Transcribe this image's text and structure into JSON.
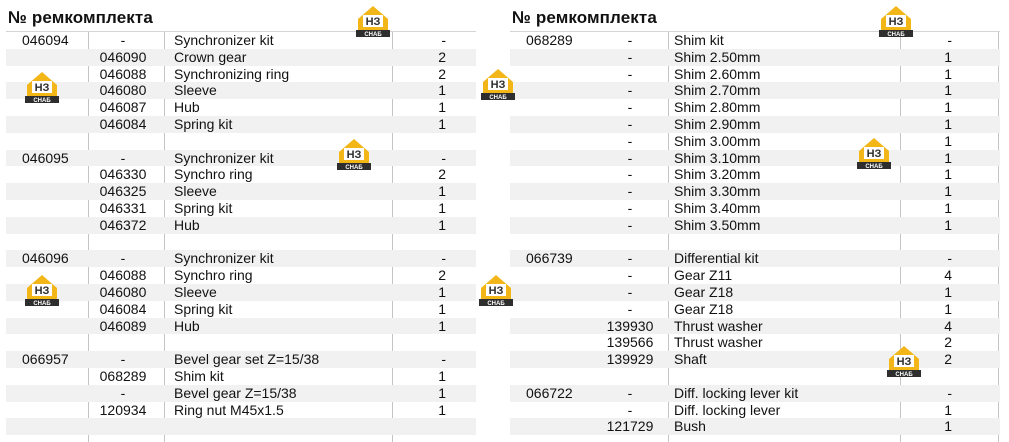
{
  "header": "№ ремкомплекта",
  "logo_text": "НЗ",
  "logo_sub": "СНАБ",
  "colors": {
    "logo_yellow": "#f2b619",
    "logo_dark": "#2e2e2e",
    "shade": "#f1f1f1"
  },
  "left_rows": [
    {
      "kit": "046094",
      "part": "-",
      "desc": "Synchronizer kit",
      "qty": "-"
    },
    {
      "kit": "",
      "part": "046090",
      "desc": "Crown gear",
      "qty": "2"
    },
    {
      "kit": "",
      "part": "046088",
      "desc": "Synchronizing ring",
      "qty": "2"
    },
    {
      "kit": "",
      "part": "046080",
      "desc": "Sleeve",
      "qty": "1"
    },
    {
      "kit": "",
      "part": "046087",
      "desc": "Hub",
      "qty": "1"
    },
    {
      "kit": "",
      "part": "046084",
      "desc": "Spring kit",
      "qty": "1"
    },
    {
      "kit": "",
      "part": "",
      "desc": "",
      "qty": ""
    },
    {
      "kit": "046095",
      "part": "-",
      "desc": "Synchronizer kit",
      "qty": "-"
    },
    {
      "kit": "",
      "part": "046330",
      "desc": "Synchro ring",
      "qty": "2"
    },
    {
      "kit": "",
      "part": "046325",
      "desc": "Sleeve",
      "qty": "1"
    },
    {
      "kit": "",
      "part": "046331",
      "desc": "Spring kit",
      "qty": "1"
    },
    {
      "kit": "",
      "part": "046372",
      "desc": "Hub",
      "qty": "1"
    },
    {
      "kit": "",
      "part": "",
      "desc": "",
      "qty": ""
    },
    {
      "kit": "046096",
      "part": "-",
      "desc": "Synchronizer kit",
      "qty": "-"
    },
    {
      "kit": "",
      "part": "046088",
      "desc": "Synchro ring",
      "qty": "2"
    },
    {
      "kit": "",
      "part": "046080",
      "desc": "Sleeve",
      "qty": "1"
    },
    {
      "kit": "",
      "part": "046084",
      "desc": "Spring kit",
      "qty": "1"
    },
    {
      "kit": "",
      "part": "046089",
      "desc": "Hub",
      "qty": "1"
    },
    {
      "kit": "",
      "part": "",
      "desc": "",
      "qty": ""
    },
    {
      "kit": "066957",
      "part": "-",
      "desc": "Bevel gear set Z=15/38",
      "qty": "-"
    },
    {
      "kit": "",
      "part": "068289",
      "desc": "Shim kit",
      "qty": "1"
    },
    {
      "kit": "",
      "part": "-",
      "desc": "Bevel gear Z=15/38",
      "qty": "1"
    },
    {
      "kit": "",
      "part": "120934",
      "desc": "Ring nut M45x1.5",
      "qty": "1"
    },
    {
      "kit": "",
      "part": "",
      "desc": "",
      "qty": ""
    }
  ],
  "right_rows": [
    {
      "kit": "068289",
      "part": "-",
      "desc": "Shim kit",
      "qty": "-"
    },
    {
      "kit": "",
      "part": "-",
      "desc": "Shim 2.50mm",
      "qty": "1"
    },
    {
      "kit": "",
      "part": "-",
      "desc": "Shim 2.60mm",
      "qty": "1"
    },
    {
      "kit": "",
      "part": "-",
      "desc": "Shim 2.70mm",
      "qty": "1"
    },
    {
      "kit": "",
      "part": "-",
      "desc": "Shim 2.80mm",
      "qty": "1"
    },
    {
      "kit": "",
      "part": "-",
      "desc": "Shim 2.90mm",
      "qty": "1"
    },
    {
      "kit": "",
      "part": "-",
      "desc": "Shim 3.00mm",
      "qty": "1"
    },
    {
      "kit": "",
      "part": "-",
      "desc": "Shim 3.10mm",
      "qty": "1"
    },
    {
      "kit": "",
      "part": "-",
      "desc": "Shim 3.20mm",
      "qty": "1"
    },
    {
      "kit": "",
      "part": "-",
      "desc": "Shim 3.30mm",
      "qty": "1"
    },
    {
      "kit": "",
      "part": "-",
      "desc": "Shim 3.40mm",
      "qty": "1"
    },
    {
      "kit": "",
      "part": "-",
      "desc": "Shim 3.50mm",
      "qty": "1"
    },
    {
      "kit": "",
      "part": "",
      "desc": "",
      "qty": ""
    },
    {
      "kit": "066739",
      "part": "-",
      "desc": "Differential kit",
      "qty": "-"
    },
    {
      "kit": "",
      "part": "-",
      "desc": "Gear Z11",
      "qty": "4"
    },
    {
      "kit": "",
      "part": "-",
      "desc": "Gear Z18",
      "qty": "1"
    },
    {
      "kit": "",
      "part": "-",
      "desc": "Gear Z18",
      "qty": "1"
    },
    {
      "kit": "",
      "part": "139930",
      "desc": "Thrust washer",
      "qty": "4"
    },
    {
      "kit": "",
      "part": "139566",
      "desc": "Thrust washer",
      "qty": "2"
    },
    {
      "kit": "",
      "part": "139929",
      "desc": "Shaft",
      "qty": "2"
    },
    {
      "kit": "",
      "part": "",
      "desc": "",
      "qty": ""
    },
    {
      "kit": "066722",
      "part": "-",
      "desc": "Diff. locking lever kit",
      "qty": "-"
    },
    {
      "kit": "",
      "part": "-",
      "desc": "Diff. locking lever",
      "qty": "1"
    },
    {
      "kit": "",
      "part": "121729",
      "desc": "Bush",
      "qty": "1"
    }
  ]
}
